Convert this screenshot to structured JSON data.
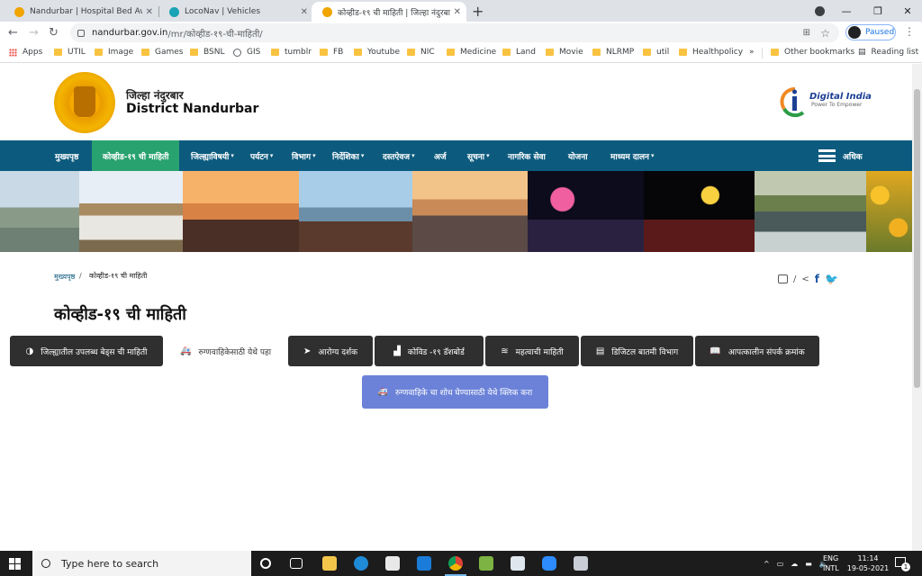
{
  "browser": {
    "tabs": [
      {
        "title": "Nandurbar | Hospital Bed Availab",
        "favicon": "#f0a500"
      },
      {
        "title": "LocoNav | Vehicles",
        "favicon": "#1aa3b5"
      },
      {
        "title": "कोव्हीड-१९ ची माहिती | जिल्हा नंदुरबा",
        "favicon": "#f0a500"
      }
    ],
    "new_tab": "+",
    "close": "✕",
    "url_host": "nandurbar.gov.in",
    "url_path": "/mr/कोव्हीड-१९-ची-माहिती/",
    "profile_label": "Paused",
    "bookmarks": [
      "Apps",
      "UTIL",
      "Image",
      "Games",
      "BSNL",
      "GIS",
      "tumblr",
      "FB",
      "Youtube",
      "NIC",
      "Medicine",
      "Land",
      "Movie",
      "NLRMP",
      "util",
      "Healthpolicy"
    ],
    "bookmarks_overflow": "»",
    "other_bookmarks": "Other bookmarks",
    "reading_list": "Reading list"
  },
  "site": {
    "title_mr": "जिल्हा नंदुरबार",
    "title_en": "District Nandurbar",
    "digital_india": "Digital India",
    "digital_india_tagline": "Power To Empower"
  },
  "nav": {
    "items": [
      {
        "label": "मुख्यपृष्ठ",
        "chevron": false
      },
      {
        "label": "कोव्हीड-१९ ची माहिती",
        "chevron": false,
        "active": true
      },
      {
        "label": "जिल्ह्याविषयी",
        "chevron": true
      },
      {
        "label": "पर्यटन",
        "chevron": true
      },
      {
        "label": "विभाग",
        "chevron": true
      },
      {
        "label": "निर्देशिका",
        "chevron": true
      },
      {
        "label": "दस्तऐवज",
        "chevron": true
      },
      {
        "label": "अर्ज",
        "chevron": false
      },
      {
        "label": "सूचना",
        "chevron": true
      },
      {
        "label": "नागरिक सेवा",
        "chevron": false
      },
      {
        "label": "योजना",
        "chevron": false
      },
      {
        "label": "माध्यम दालन",
        "chevron": true
      }
    ],
    "more_label": "अधिक",
    "chevron_glyph": "▾"
  },
  "breadcrumb": {
    "home": "मुख्यपृष्ठ",
    "separator": "/",
    "current": "कोव्हीड-१९ ची माहिती"
  },
  "share": {
    "separator": "/"
  },
  "page_title": "कोव्हीड-१९ ची माहिती",
  "tabs": [
    {
      "label": "जिल्ह्यातील उपलब्ध बेड्स ची माहिती",
      "icon": "◑"
    },
    {
      "label": "रुग्णवाहिकेसाठी येथे पहा",
      "icon": "🚑",
      "active": true
    },
    {
      "label": "आरोग्य दर्शक",
      "icon": "➤"
    },
    {
      "label": "कोविड -१९ डॅशबोर्ड",
      "icon": "▟"
    },
    {
      "label": "महत्वाची माहिती",
      "icon": "≋"
    },
    {
      "label": "डिजिटल बातमी विभाग",
      "icon": "▤"
    },
    {
      "label": "आपत्कालीन संपर्क क्रमांक",
      "icon": "📖"
    }
  ],
  "cta": {
    "label": "रुग्णवाहिके चा शोध घेण्यासाठी येथे क्लिक करा",
    "icon": "🚑"
  },
  "taskbar": {
    "search_placeholder": "Type here to search",
    "lang_top": "ENG",
    "lang_bottom": "INTL",
    "time": "11:14",
    "date": "19-05-2021",
    "notification_count": "1"
  },
  "colors": {
    "nav": "#0c5b7e",
    "nav_active": "#28a26e",
    "tab_dark": "#2f2f2f",
    "cta": "#6b82d8"
  }
}
